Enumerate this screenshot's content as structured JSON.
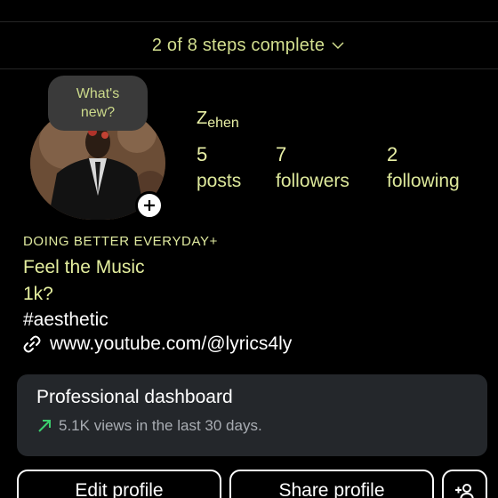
{
  "steps": {
    "text": "2 of 8 steps complete"
  },
  "profile": {
    "note": [
      "What's",
      "new?"
    ],
    "username_main": "Z",
    "username_sub": "ehen",
    "stats": [
      {
        "value": "5",
        "label": "posts"
      },
      {
        "value": "7",
        "label": "followers"
      },
      {
        "value": "2",
        "label": "following"
      }
    ]
  },
  "bio": {
    "name": "DOING BETTER EVERYDAY+",
    "lines": [
      "Feel the Music",
      "1k?"
    ],
    "hashtag": "#aesthetic",
    "link": "www.youtube.com/@lyrics4ly"
  },
  "dashboard": {
    "title": "Professional dashboard",
    "subtitle": "5.1K views in the last 30 days.",
    "trend_color": "#3ccf6e"
  },
  "buttons": {
    "edit": "Edit profile",
    "share": "Share profile"
  },
  "icons": {
    "steps_toggle": "chevron-down-icon",
    "add_story": "plus-icon",
    "link": "link-icon",
    "trend": "trend-up-icon",
    "add_person": "add-person-icon"
  },
  "colors": {
    "accent_text": "#e9f0a6",
    "background": "#000000",
    "card": "#24272b"
  }
}
